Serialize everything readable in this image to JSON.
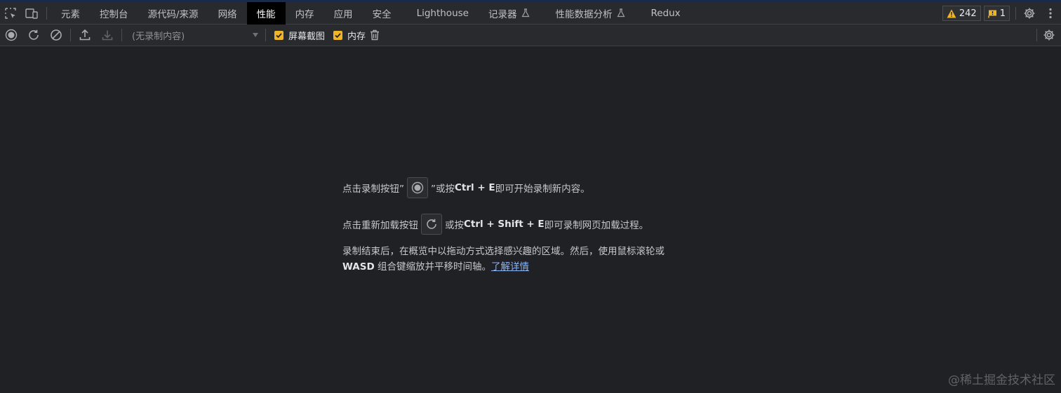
{
  "tabs": [
    {
      "label": "元素",
      "active": false
    },
    {
      "label": "控制台",
      "active": false
    },
    {
      "label": "源代码/来源",
      "active": false
    },
    {
      "label": "网络",
      "active": false
    },
    {
      "label": "性能",
      "active": true
    },
    {
      "label": "内存",
      "active": false
    },
    {
      "label": "应用",
      "active": false
    },
    {
      "label": "安全",
      "active": false
    },
    {
      "label": "Lighthouse",
      "active": false
    },
    {
      "label": "记录器",
      "active": false,
      "experimental": true
    },
    {
      "label": "性能数据分析",
      "active": false,
      "experimental": true
    },
    {
      "label": "Redux",
      "active": false
    }
  ],
  "badges": {
    "warnings": "242",
    "issues": "1"
  },
  "toolbar": {
    "recording_select": "(无录制内容)",
    "screenshots_label": "屏幕截图",
    "screenshots_checked": true,
    "memory_label": "内存",
    "memory_checked": true
  },
  "landing": {
    "line1_prefix": "点击录制按钮”",
    "line1_mid": "”或按 ",
    "line1_key": "Ctrl + E",
    "line1_suffix": " 即可开始录制新内容。",
    "line2_prefix": "点击重新加载按钮",
    "line2_mid": " 或按 ",
    "line2_key": "Ctrl + Shift + E",
    "line2_suffix": " 即可录制网页加载过程。",
    "para_line1": "录制结束后，在概览中以拖动方式选择感兴趣的区域。然后，使用鼠标滚轮或",
    "para_key": "WASD",
    "para_line2": " 组合键缩放并平移时间轴。",
    "learn_more": "了解详情"
  },
  "watermark": "@稀土掘金技术社区",
  "colors": {
    "background": "#202124",
    "toolbar": "#292a2d",
    "active_tab": "#000000",
    "checkbox": "#f0b429",
    "warning": "#f0b429",
    "link": "#8ab4f8"
  }
}
